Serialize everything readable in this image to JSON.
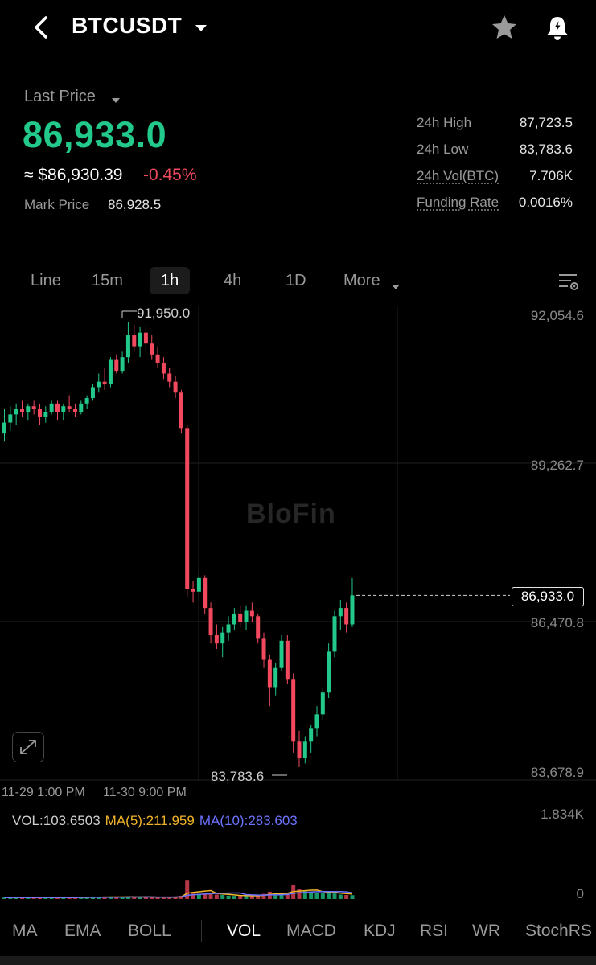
{
  "header": {
    "pair": "BTCUSDT"
  },
  "price": {
    "last_price_label": "Last Price",
    "last_price": "86,933.0",
    "usd_approx": "≈ $86,930.39",
    "change": "-0.45%",
    "mark_label": "Mark Price",
    "mark_value": "86,928.5"
  },
  "stats": [
    {
      "label": "24h High",
      "value": "87,723.5"
    },
    {
      "label": "24h Low",
      "value": "83,783.6"
    },
    {
      "label": "24h Vol(BTC)",
      "value": "7.706K"
    },
    {
      "label": "Funding Rate",
      "value": "0.0016%"
    }
  ],
  "timeframes": {
    "line": "Line",
    "m15": "15m",
    "h1": "1h",
    "h4": "4h",
    "d1": "1D",
    "more": "More"
  },
  "chart": {
    "axis": [
      "92,054.6",
      "89,262.7",
      "86,470.8",
      "83,678.9"
    ],
    "current_price": "86,933.0",
    "high_marker": "91,950.0",
    "low_marker": "83,783.6",
    "watermark": "BloFin",
    "time_labels": [
      "11-29 1:00 PM",
      "11-30 9:00 PM"
    ]
  },
  "volume": {
    "vol": "VOL:103.6503",
    "ma5": "MA(5):211.959",
    "ma10": "MA(10):283.603",
    "max": "1.834K",
    "zero": "0"
  },
  "indicators": {
    "ma": "MA",
    "ema": "EMA",
    "boll": "BOLL",
    "vol": "VOL",
    "macd": "MACD",
    "kdj": "KDJ",
    "rsi": "RSI",
    "wr": "WR",
    "stochrsi": "StochRS"
  },
  "colors": {
    "up": "#22c98a",
    "down": "#f2495f",
    "ma5": "#f0b429",
    "ma10": "#6b73ff"
  },
  "chart_data": {
    "type": "candlestick",
    "y_range": [
      83678.9,
      92054.6
    ],
    "candles": [
      [
        89900,
        90350,
        89750,
        90100
      ],
      [
        90100,
        90400,
        89950,
        90250
      ],
      [
        90250,
        90450,
        90050,
        90350
      ],
      [
        90350,
        90500,
        90200,
        90300
      ],
      [
        90300,
        90450,
        90150,
        90400
      ],
      [
        90400,
        90500,
        90250,
        90350
      ],
      [
        90350,
        90450,
        90050,
        90200
      ],
      [
        90200,
        90400,
        90100,
        90300
      ],
      [
        90300,
        90500,
        90250,
        90450
      ],
      [
        90450,
        90500,
        90150,
        90300
      ],
      [
        90300,
        90450,
        90150,
        90400
      ],
      [
        90400,
        90600,
        90300,
        90350
      ],
      [
        90350,
        90450,
        90200,
        90300
      ],
      [
        90300,
        90500,
        90250,
        90450
      ],
      [
        90450,
        90600,
        90350,
        90550
      ],
      [
        90550,
        90800,
        90500,
        90750
      ],
      [
        90750,
        91000,
        90650,
        90850
      ],
      [
        90850,
        91100,
        90700,
        90800
      ],
      [
        90800,
        91300,
        90750,
        91250
      ],
      [
        91250,
        91350,
        91000,
        91050
      ],
      [
        91050,
        91400,
        91000,
        91300
      ],
      [
        91300,
        91950,
        91200,
        91700
      ],
      [
        91700,
        91900,
        91400,
        91500
      ],
      [
        91500,
        91850,
        91300,
        91750
      ],
      [
        91750,
        91900,
        91400,
        91550
      ],
      [
        91550,
        91700,
        91250,
        91350
      ],
      [
        91350,
        91500,
        91100,
        91200
      ],
      [
        91200,
        91300,
        90900,
        91000
      ],
      [
        91000,
        91100,
        90750,
        90850
      ],
      [
        90850,
        90950,
        90550,
        90650
      ],
      [
        90650,
        90700,
        89900,
        90000
      ],
      [
        90000,
        90050,
        86900,
        87050
      ],
      [
        87050,
        87200,
        86800,
        87000
      ],
      [
        87000,
        87350,
        86900,
        87250
      ],
      [
        87250,
        87300,
        86600,
        86700
      ],
      [
        86700,
        86800,
        86050,
        86200
      ],
      [
        86200,
        86400,
        85950,
        86050
      ],
      [
        86050,
        86350,
        85800,
        86250
      ],
      [
        86250,
        86550,
        86100,
        86400
      ],
      [
        86400,
        86700,
        86300,
        86600
      ],
      [
        86600,
        86750,
        86350,
        86450
      ],
      [
        86450,
        86750,
        86300,
        86650
      ],
      [
        86650,
        86800,
        86450,
        86550
      ],
      [
        86550,
        86600,
        86050,
        86150
      ],
      [
        86150,
        86250,
        85600,
        85750
      ],
      [
        85750,
        85850,
        84900,
        85250
      ],
      [
        85250,
        85700,
        85100,
        85600
      ],
      [
        85600,
        86200,
        85550,
        86100
      ],
      [
        86100,
        86200,
        85300,
        85400
      ],
      [
        85400,
        85500,
        84050,
        84250
      ],
      [
        84250,
        84450,
        83783.6,
        83950
      ],
      [
        83950,
        84350,
        83850,
        84250
      ],
      [
        84250,
        84550,
        84050,
        84500
      ],
      [
        84500,
        84900,
        84350,
        84750
      ],
      [
        84750,
        85250,
        84650,
        85150
      ],
      [
        85150,
        86050,
        85050,
        85900
      ],
      [
        85900,
        86650,
        85800,
        86550
      ],
      [
        86550,
        86850,
        86300,
        86700
      ],
      [
        86700,
        86800,
        86250,
        86400
      ],
      [
        86400,
        87250,
        86350,
        86933
      ]
    ],
    "volume": [
      40,
      35,
      55,
      30,
      45,
      38,
      42,
      50,
      36,
      44,
      40,
      48,
      35,
      52,
      46,
      60,
      58,
      45,
      62,
      50,
      55,
      70,
      48,
      52,
      58,
      45,
      42,
      50,
      55,
      60,
      85,
      520,
      180,
      140,
      160,
      150,
      120,
      110,
      90,
      85,
      80,
      95,
      88,
      100,
      140,
      200,
      150,
      130,
      160,
      380,
      260,
      210,
      190,
      170,
      160,
      200,
      150,
      120,
      110,
      104
    ]
  }
}
